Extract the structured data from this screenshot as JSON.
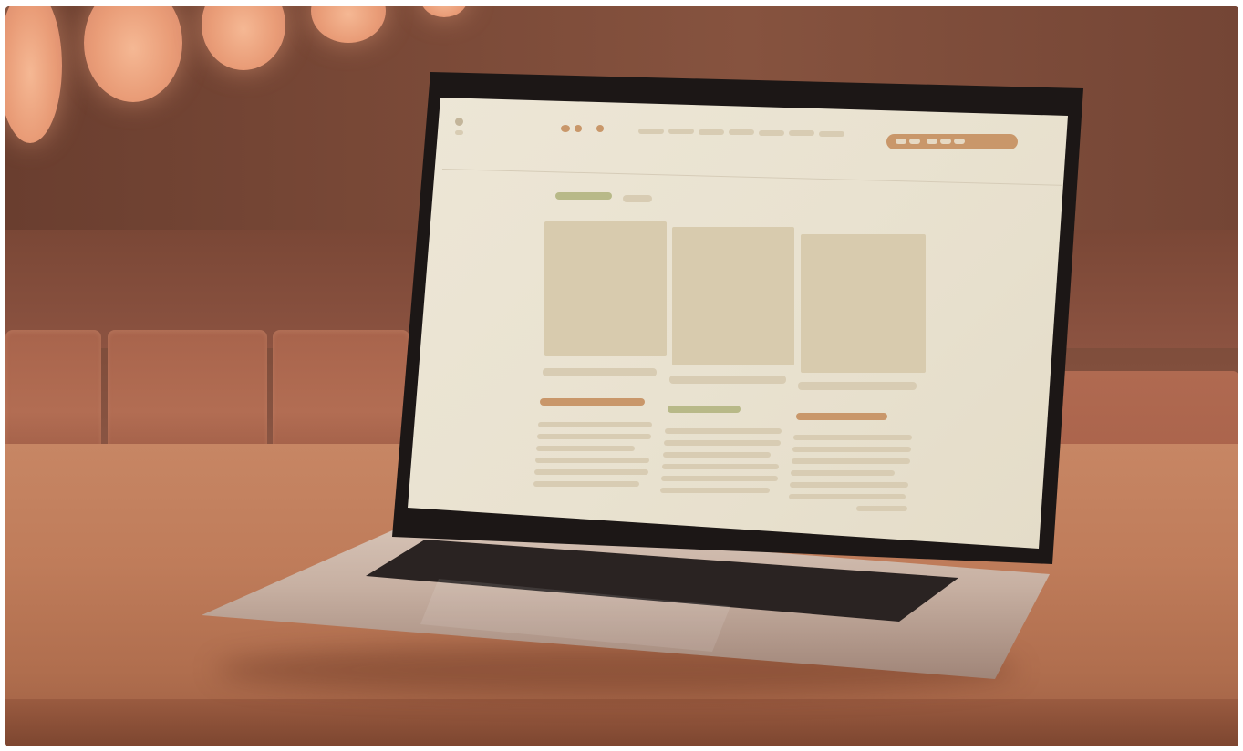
{
  "scene": {
    "description_free": true,
    "colors": {
      "background_wall": "#7b4a38",
      "lamp": "#e99c77",
      "table": "#bf7c5a",
      "screen": "#ebe4d3",
      "placeholder_line": "#d8ccb3",
      "placeholder_accent": "#c9976a",
      "placeholder_green": "#b8b988"
    }
  },
  "icons": {
    "logo": "app-logo-icon"
  }
}
